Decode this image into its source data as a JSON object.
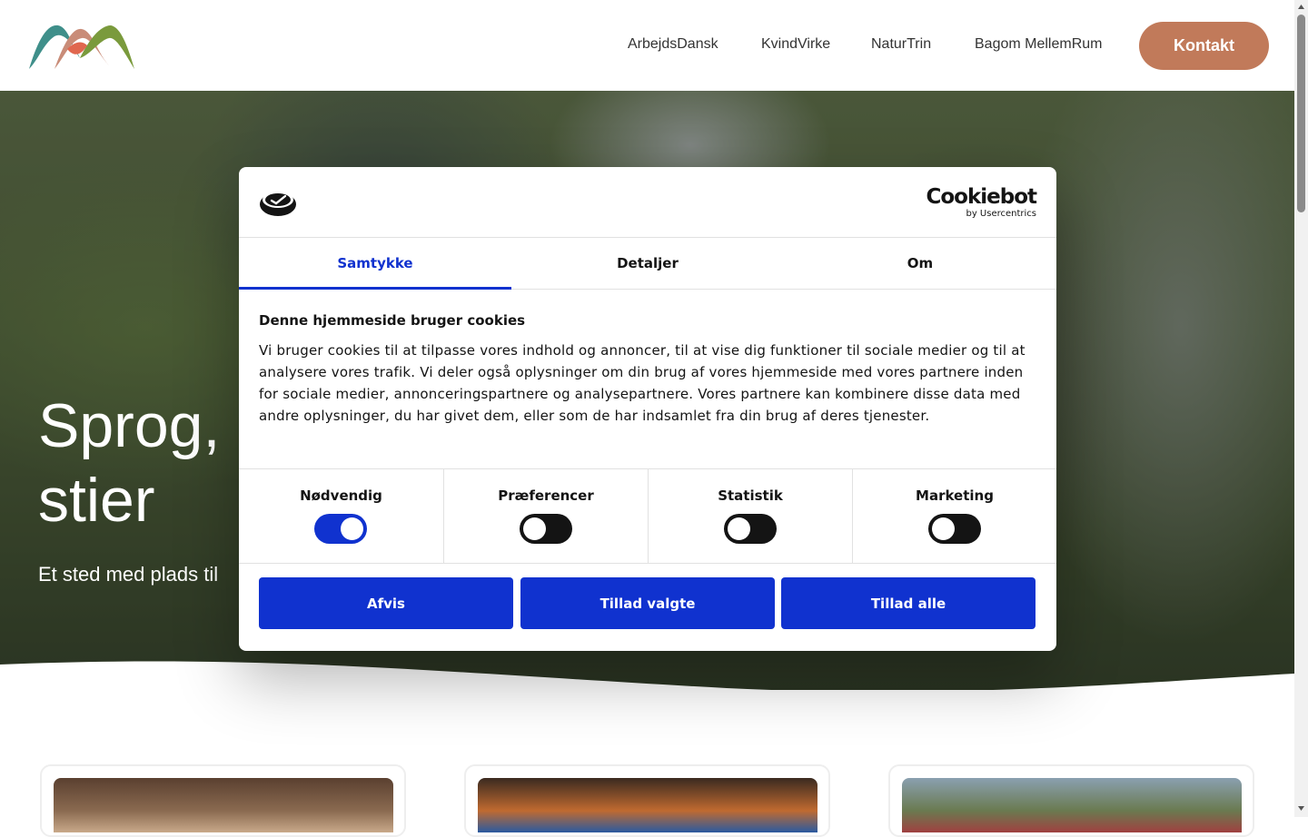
{
  "header": {
    "nav": [
      "ArbejdsDansk",
      "KvindVirke",
      "NaturTrin",
      "Bagom MellemRum"
    ],
    "cta_label": "Kontakt"
  },
  "hero": {
    "title": "Sprog,\nstier",
    "subtitle": "Et sted med plads til"
  },
  "cookie_dialog": {
    "brand_name": "Cookiebot",
    "brand_by": "by Usercentrics",
    "tabs": [
      {
        "label": "Samtykke",
        "active": true
      },
      {
        "label": "Detaljer",
        "active": false
      },
      {
        "label": "Om",
        "active": false
      }
    ],
    "title": "Denne hjemmeside bruger cookies",
    "body": "Vi bruger cookies til at tilpasse vores indhold og annoncer, til at vise dig funktioner til sociale medier og til at analysere vores trafik. Vi deler også oplysninger om din brug af vores hjemmeside med vores partnere inden for sociale medier, annonceringspartnere og analysepartnere. Vores partnere kan kombinere disse data med andre oplysninger, du har givet dem, eller som de har indsamlet fra din brug af deres tjenester.",
    "toggles": [
      {
        "label": "Nødvendig",
        "on": true
      },
      {
        "label": "Præferencer",
        "on": false
      },
      {
        "label": "Statistik",
        "on": false
      },
      {
        "label": "Marketing",
        "on": false
      }
    ],
    "buttons": {
      "reject": "Afvis",
      "allow_selected": "Tillad valgte",
      "allow_all": "Tillad alle"
    }
  },
  "colors": {
    "accent": "#1032cf",
    "cta": "#c17a5a",
    "text": "#141414"
  },
  "icons": {
    "site_logo": "mountain-logo-icon",
    "cookiebot_logo": "cookiebot-icon"
  }
}
